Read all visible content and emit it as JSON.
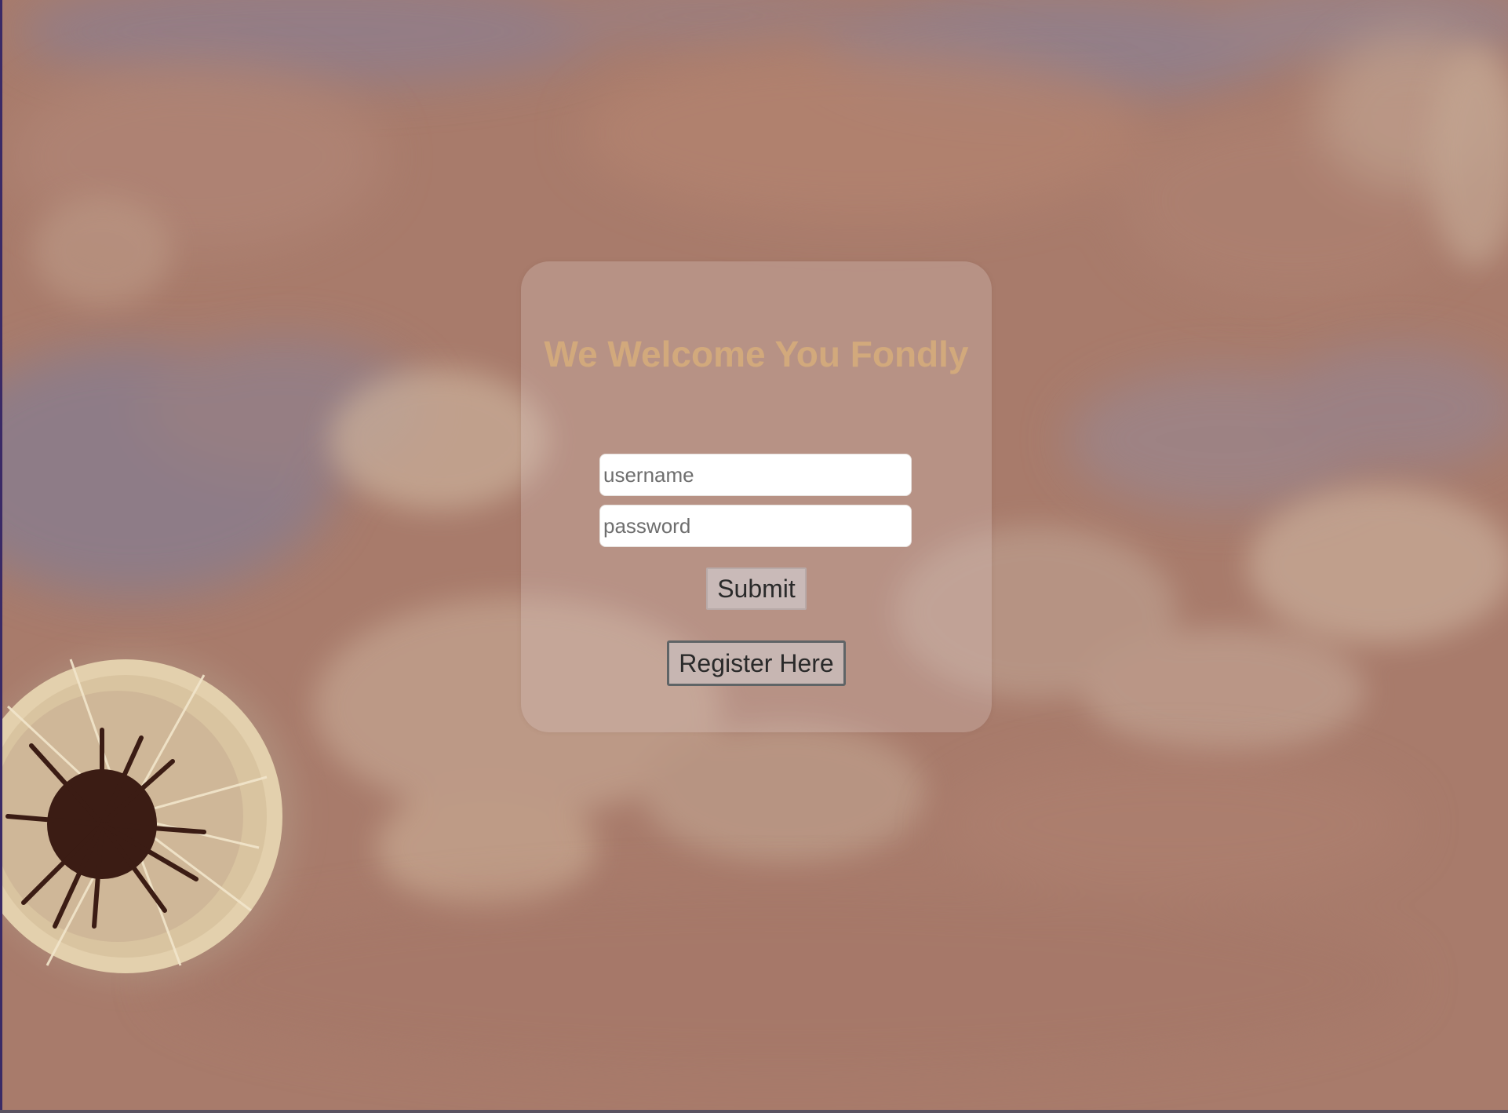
{
  "login": {
    "title": "We Welcome You Fondly",
    "username_placeholder": "username",
    "password_placeholder": "password",
    "submit_label": "Submit",
    "register_label": "Register Here"
  },
  "colors": {
    "background": "#a87c6c",
    "title": "#d2a97c",
    "card": "rgba(220,200,195,0.30)"
  }
}
